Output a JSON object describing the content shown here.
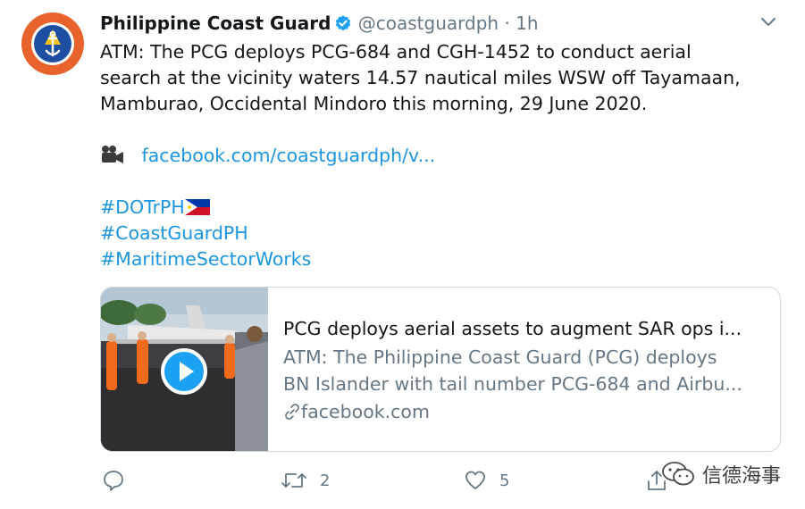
{
  "tweet": {
    "author_name": "Philippine Coast Guard",
    "handle": "@coastguardph",
    "separator": "·",
    "time": "1h",
    "body_lines": [
      "ATM: The PCG deploys PCG-684 and CGH-1452 to conduct aerial",
      "search at the vicinity waters 14.57 nautical miles WSW off Tayamaan,",
      "Mamburao, Occidental Mindoro this morning, 29 June 2020."
    ],
    "video_icon": "video-camera-icon",
    "link": "facebook.com/coastguardph/v...",
    "hashtags": [
      "#DOTrPH",
      "#CoastGuardPH",
      "#MaritimeSectorWorks"
    ],
    "flag_icon": "philippines-flag-icon"
  },
  "card": {
    "title": "PCG deploys aerial assets to augment SAR ops i...",
    "desc_lines": [
      "ATM: The Philippine Coast Guard (PCG) deploys",
      "BN Islander with tail number PCG-684 and Airbu..."
    ],
    "domain": "facebook.com"
  },
  "actions": {
    "reply_count": "",
    "retweet_count": "2",
    "like_count": "5"
  },
  "watermark": {
    "text": "信德海事"
  },
  "colors": {
    "link": "#1b95e0",
    "secondary": "#657786",
    "verified": "#1da1f2",
    "avatar_ring": "#e8622c",
    "avatar_inner": "#1d4ea1"
  }
}
